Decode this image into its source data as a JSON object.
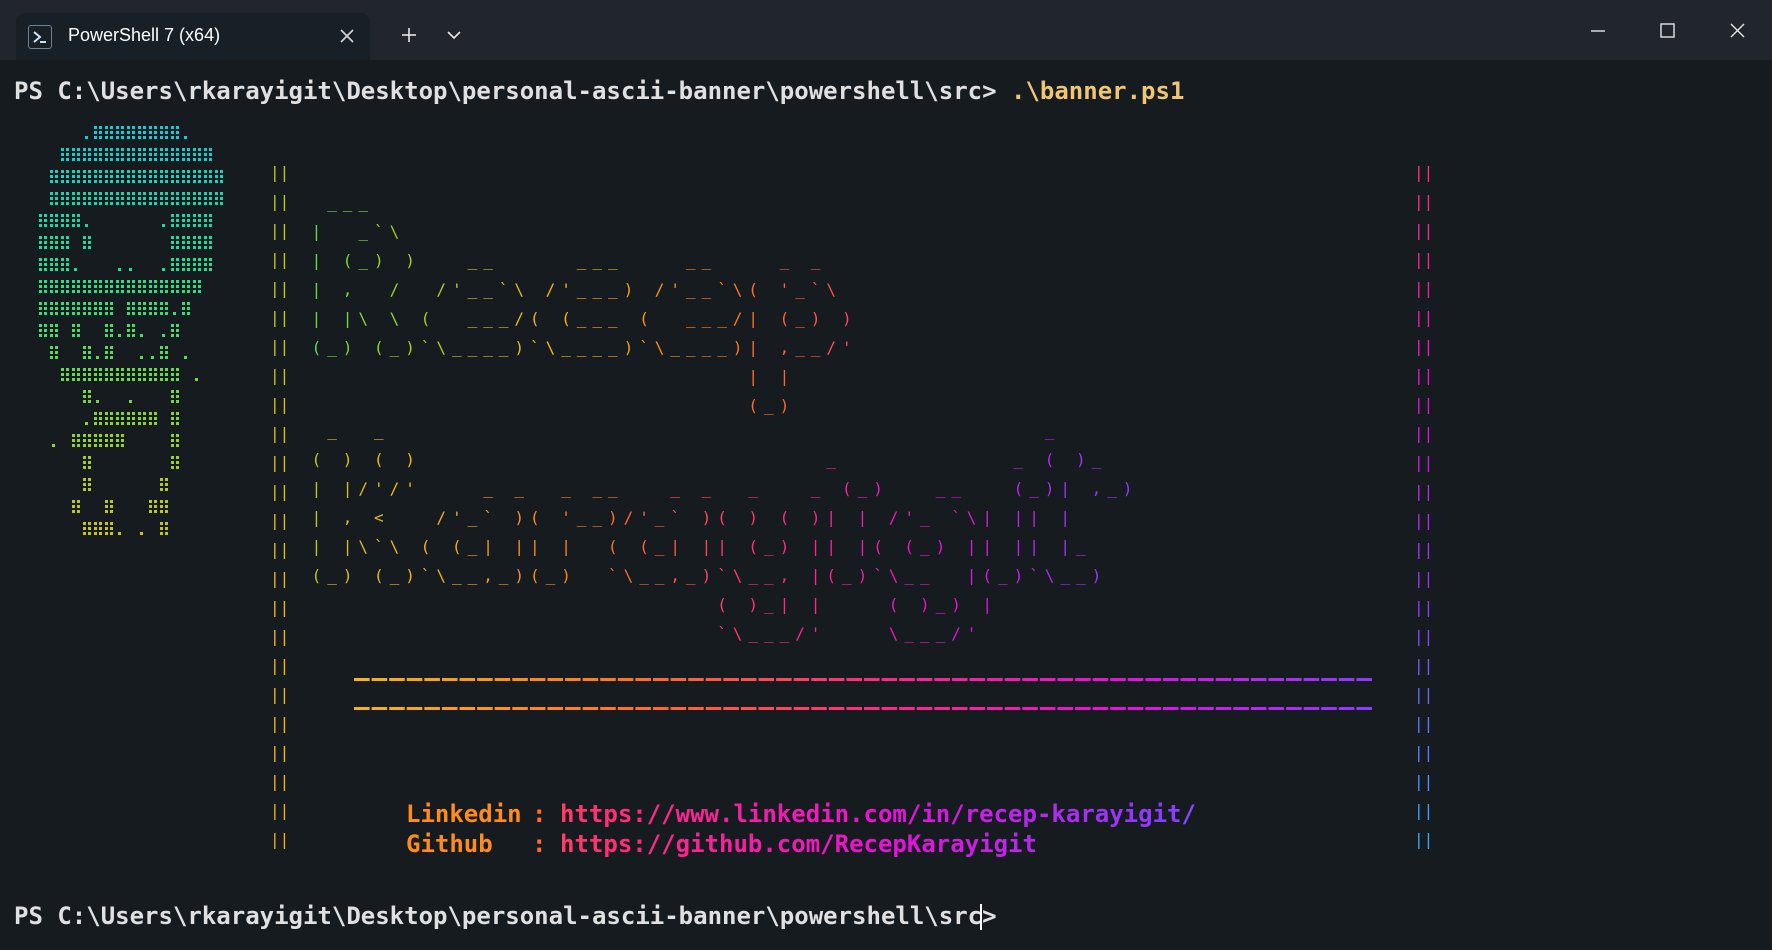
{
  "window": {
    "tab_title": "PowerShell 7 (x64)",
    "icons": [
      "powershell-icon",
      "close-icon",
      "plus-icon",
      "chevron-down-icon",
      "minimize-icon",
      "maximize-icon",
      "close-icon"
    ]
  },
  "terminal": {
    "prompt": "PS C:\\Users\\rkarayigit\\Desktop\\personal-ascii-banner\\powershell\\src> ",
    "command": ".\\banner.ps1",
    "prompt2": "PS C:\\Users\\rkarayigit\\Desktop\\personal-ascii-banner\\powershell\\src> ",
    "colors": {
      "background": "#161b20",
      "titlebar": "#20262c",
      "command": "#f0c674",
      "gradient": [
        "#12c7e4",
        "#1de08a",
        "#8ed52a",
        "#f2b61c",
        "#ff7a1a",
        "#ff2c7a",
        "#e612d8",
        "#8a3cff",
        "#3ba7ff"
      ]
    }
  },
  "banner": {
    "border": "||",
    "name_art": [
      "  ___",
      " |  _`\\",
      " | (_) )   __     ___    __    _ _",
      " | ,  /  /'__`\\ /'___) /'__`\\( '_`\\",
      " | |\\ \\ (  ___/( (___ (  ___/| (_) )",
      " (_) (_)`\\____)`\\____)`\\____)| ,__/'",
      "                             | |",
      "                             (_)"
    ],
    "surname_art": [
      "  _  _                                          _",
      " ( ) ( )                          _           _ ( )_",
      " | |/'/'    _ _  _ __   _ _  _   _ (_)   __   (_)| ,_)",
      " | , <   /'_` )( '__)/'_` )( ) ( )| | /'_ `\\| || |",
      " | |\\`\\ ( (_| || |  ( (_| || (_) || |( (_) || || |_",
      " (_) (_)`\\__,_)(_)  `\\__,_)`\\__, |(_)`\\__  |(_)`\\__)",
      "                           ( )_| |    ( )_) |",
      "                           `\\___/'    \\___/'"
    ],
    "divider": "------------------------------------------------------------------------",
    "links": [
      {
        "label": "Linkedin",
        "sep": ":",
        "url": "https://www.linkedin.com/in/recep-karayigit/"
      },
      {
        "label": "Github",
        "sep": ":",
        "url": "https://github.com/RecepKarayigit"
      }
    ]
  },
  "avatar": {
    "rows": [
      "     .::::::::.",
      "   ::::::::::::::",
      "  ::::::::::::::::",
      "  ::::::::::::::::",
      " ::::.      .::::",
      " ::: :       ::::",
      " :::.   ..  .::::",
      " :::::::::::::::",
      " ::::::: ::::.:",
      " :: :  :.:. .:",
      "  :  :.:  ..: .",
      "   ::::::::::: .",
      "     :.  .   :",
      "     .:::::: :",
      "  . :::::    :",
      "     :       :",
      "     :      :",
      "    :  :   ::",
      "     :::. . :"
    ]
  }
}
